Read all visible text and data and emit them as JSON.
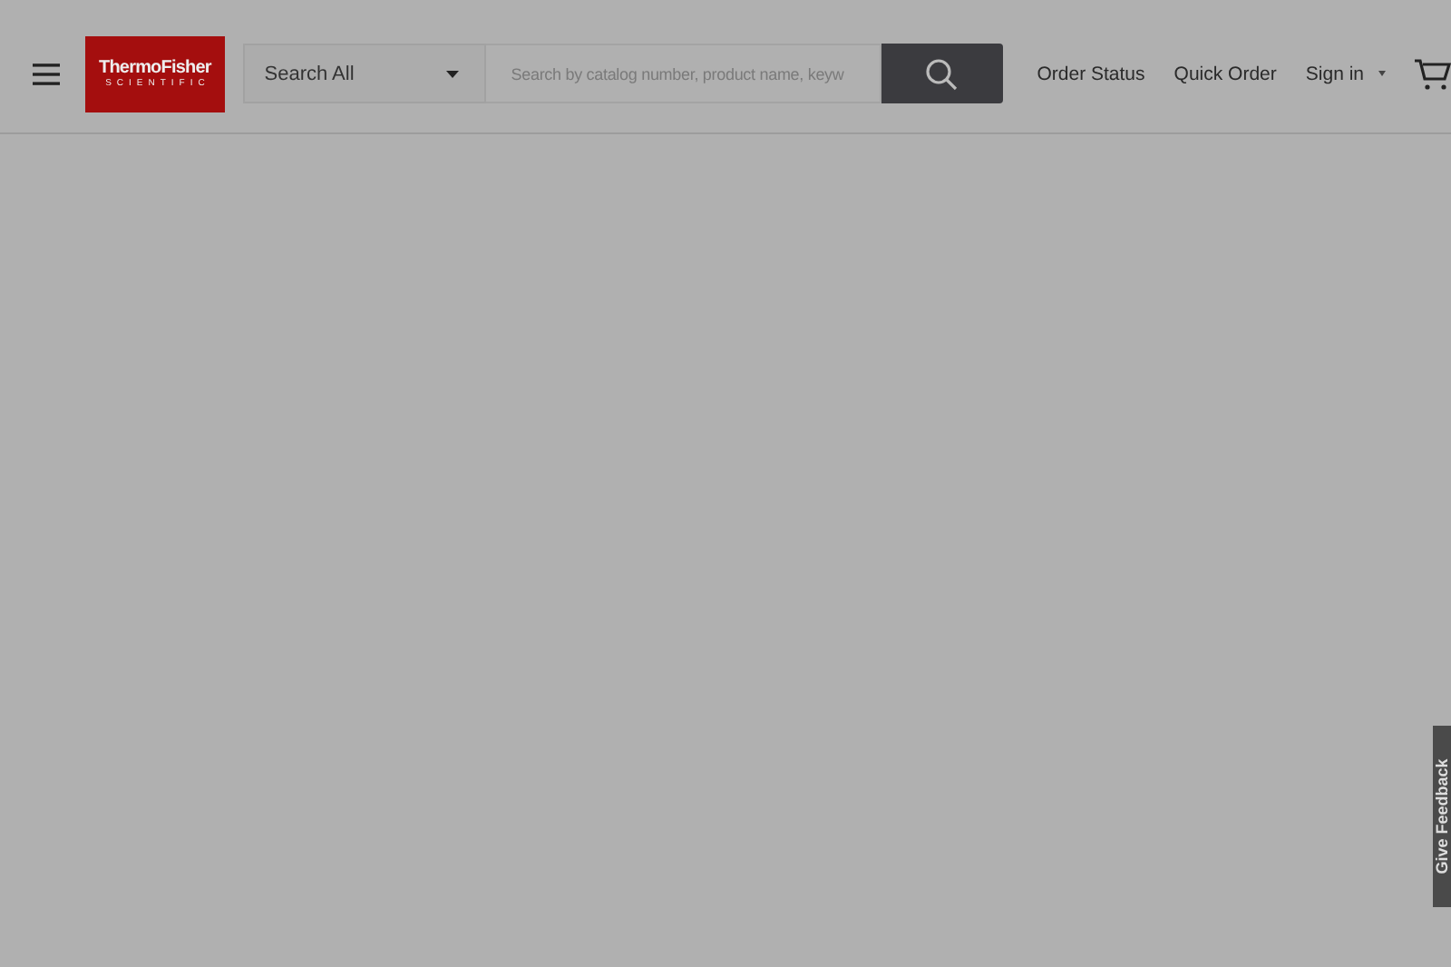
{
  "header": {
    "logo": {
      "name": "ThermoFisher",
      "tagline": "SCIENTIFIC"
    },
    "search": {
      "category": "Search All",
      "placeholder": "Search by catalog number, product name, keyw"
    },
    "nav": [
      {
        "label": "Order Status",
        "kind": "link"
      },
      {
        "label": "Quick Order",
        "kind": "link"
      },
      {
        "label": "Sign in",
        "kind": "dropdown"
      }
    ]
  },
  "feedback": {
    "label": "Give Feedback"
  }
}
